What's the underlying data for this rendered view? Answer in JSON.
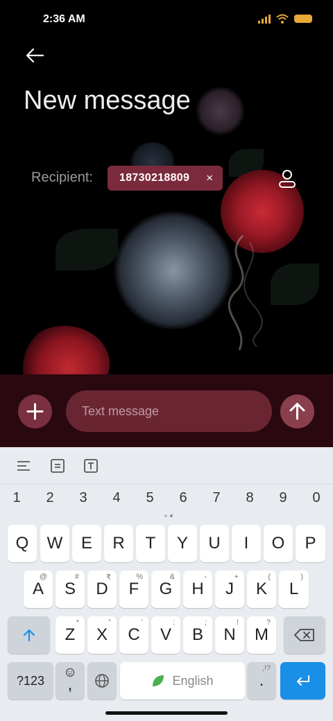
{
  "status_bar": {
    "time": "2:36 AM",
    "signal_icon": "signal-icon",
    "wifi_icon": "wifi-icon",
    "battery_icon": "battery-icon",
    "accent_color": "#e8a93a"
  },
  "header": {
    "back_icon": "arrow-left-icon",
    "title": "New message"
  },
  "recipient": {
    "label": "Recipient:",
    "chips": [
      {
        "number": "18730218809",
        "remove_label": "×"
      }
    ],
    "contact_icon": "person-icon"
  },
  "compose": {
    "add_icon": "plus-icon",
    "placeholder": "Text message",
    "send_icon": "arrow-up-icon",
    "accent_color": "#7b2a3e"
  },
  "keyboard": {
    "toolbar": [
      "menu-lines-icon",
      "clipboard-icon",
      "text-box-icon"
    ],
    "numbers": [
      "1",
      "2",
      "3",
      "4",
      "5",
      "6",
      "7",
      "8",
      "9",
      "0"
    ],
    "rows": [
      [
        {
          "key": "Q",
          "hint": ""
        },
        {
          "key": "W",
          "hint": ""
        },
        {
          "key": "E",
          "hint": ""
        },
        {
          "key": "R",
          "hint": ""
        },
        {
          "key": "T",
          "hint": ""
        },
        {
          "key": "Y",
          "hint": ""
        },
        {
          "key": "U",
          "hint": ""
        },
        {
          "key": "I",
          "hint": ""
        },
        {
          "key": "O",
          "hint": ""
        },
        {
          "key": "P",
          "hint": ""
        }
      ],
      [
        {
          "key": "A",
          "hint": "@"
        },
        {
          "key": "S",
          "hint": "#"
        },
        {
          "key": "D",
          "hint": "₹"
        },
        {
          "key": "F",
          "hint": "%"
        },
        {
          "key": "G",
          "hint": "&"
        },
        {
          "key": "H",
          "hint": "-"
        },
        {
          "key": "J",
          "hint": "+"
        },
        {
          "key": "K",
          "hint": "("
        },
        {
          "key": "L",
          "hint": ")"
        }
      ],
      [
        {
          "key": "Z",
          "hint": "*"
        },
        {
          "key": "X",
          "hint": "\""
        },
        {
          "key": "C",
          "hint": "'"
        },
        {
          "key": "V",
          "hint": ":"
        },
        {
          "key": "B",
          "hint": ";"
        },
        {
          "key": "N",
          "hint": "!"
        },
        {
          "key": "M",
          "hint": "?"
        }
      ]
    ],
    "shift_icon": "shift-arrow-icon",
    "backspace_icon": "backspace-icon",
    "symbols_label": "?123",
    "emoji_comma": ",",
    "emoji_icon": "emoji-icon",
    "globe_icon": "globe-icon",
    "space_label": "English",
    "space_icon": "leaf-icon",
    "period_label": ".",
    "period_hint": ",!?",
    "enter_icon": "enter-icon",
    "enter_color": "#1a8fe8"
  }
}
